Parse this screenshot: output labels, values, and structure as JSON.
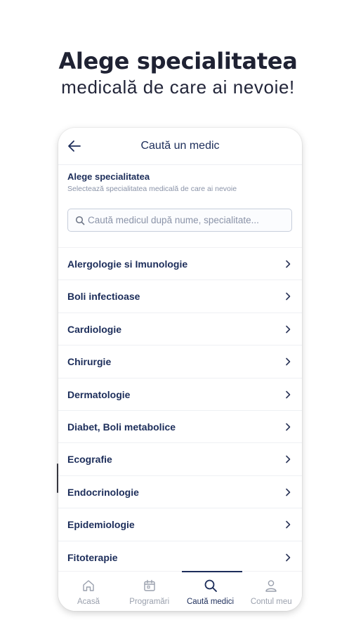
{
  "headline": {
    "title": "Alege specialitatea",
    "subtitle": "medicală de care ai nevoie!"
  },
  "appbar": {
    "title": "Caută un medic",
    "back_icon": "arrow-left-icon"
  },
  "section": {
    "title": "Alege specialitatea",
    "subtitle": "Selectează specialitatea medicală de care ai nevoie"
  },
  "search": {
    "placeholder": "Caută medicul după nume, specialitate...",
    "value": "",
    "icon": "search-icon"
  },
  "specialties": [
    {
      "label": "Alergologie si Imunologie"
    },
    {
      "label": "Boli infectioase"
    },
    {
      "label": "Cardiologie"
    },
    {
      "label": "Chirurgie"
    },
    {
      "label": "Dermatologie"
    },
    {
      "label": "Diabet, Boli metabolice"
    },
    {
      "label": "Ecografie"
    },
    {
      "label": "Endocrinologie"
    },
    {
      "label": "Epidemiologie"
    },
    {
      "label": "Fitoterapie"
    }
  ],
  "tabs": [
    {
      "label": "Acasă",
      "icon": "home-icon",
      "active": false
    },
    {
      "label": "Programări",
      "icon": "calendar-icon",
      "active": false
    },
    {
      "label": "Caută medici",
      "icon": "search-icon",
      "active": true
    },
    {
      "label": "Contul meu",
      "icon": "user-icon",
      "active": false
    }
  ],
  "colors": {
    "primary": "#1c2d5a",
    "muted": "#9aa0ad",
    "subtext": "#8a93a8",
    "divider": "#eef0f4"
  }
}
